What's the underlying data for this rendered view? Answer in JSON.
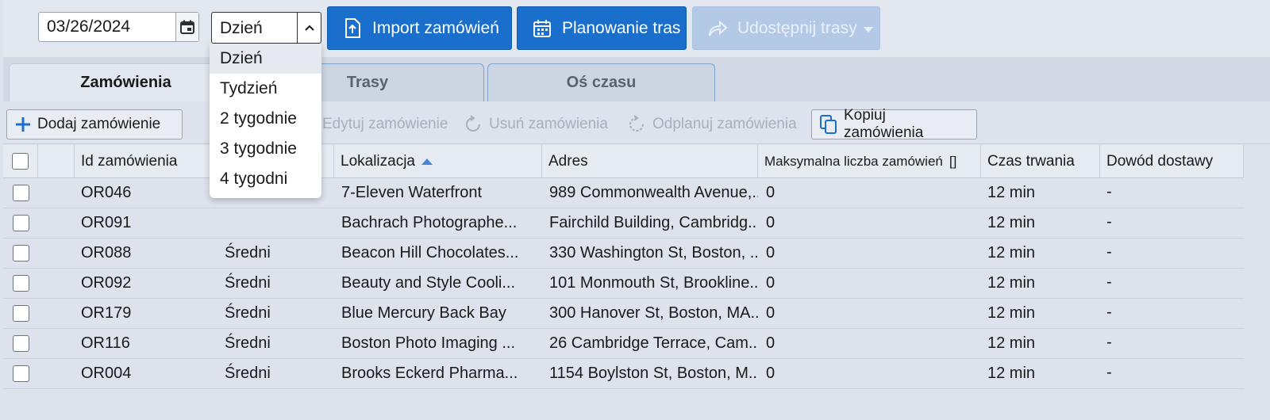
{
  "toolbar": {
    "date": "03/26/2024",
    "period_value": "Dzień",
    "import_label": "Import zamówień",
    "planning_label": "Planowanie tras",
    "share_label": "Udostępnij trasy"
  },
  "dropdown": {
    "options": [
      "Dzień",
      "Tydzień",
      "2 tygodnie",
      "3 tygodnie",
      "4 tygodni"
    ],
    "selected": "Dzień"
  },
  "tabs": [
    {
      "label": "Zamówienia",
      "active": true
    },
    {
      "label": "Trasy",
      "active": false
    },
    {
      "label": "Oś czasu",
      "active": false
    }
  ],
  "actions": {
    "add": "Dodaj zamówienie",
    "edit": "Edytuj zamówienie",
    "delete": "Usuń zamówienia",
    "unplan": "Odplanuj zamówienia",
    "copy": "Kopiuj zamówienia"
  },
  "table": {
    "columns": {
      "id": "Id zamówienia",
      "priority": "",
      "location": "Lokalizacja",
      "address": "Adres",
      "max_orders": "Maksymalna liczba zamówień",
      "duration": "Czas trwania",
      "proof": "Dowód dostawy"
    },
    "max_orders_marker": "[]",
    "sort_column": "location",
    "rows": [
      {
        "id": "OR046",
        "priority": "",
        "location": "7-Eleven Waterfront",
        "address": "989 Commonwealth Avenue,...",
        "max_orders": "0",
        "duration": "12 min",
        "proof": "-"
      },
      {
        "id": "OR091",
        "priority": "",
        "location": "Bachrach Photographe...",
        "address": "Fairchild Building, Cambridg...",
        "max_orders": "0",
        "duration": "12 min",
        "proof": "-"
      },
      {
        "id": "OR088",
        "priority": "Średni",
        "location": "Beacon Hill Chocolates...",
        "address": "330 Washington St, Boston, ...",
        "max_orders": "0",
        "duration": "12 min",
        "proof": "-"
      },
      {
        "id": "OR092",
        "priority": "Średni",
        "location": "Beauty and Style Cooli...",
        "address": "101 Monmouth St, Brookline...",
        "max_orders": "0",
        "duration": "12 min",
        "proof": "-"
      },
      {
        "id": "OR179",
        "priority": "Średni",
        "location": "Blue Mercury Back Bay",
        "address": "300 Hanover St, Boston, MA...",
        "max_orders": "0",
        "duration": "12 min",
        "proof": "-"
      },
      {
        "id": "OR116",
        "priority": "Średni",
        "location": "Boston Photo Imaging ...",
        "address": "26 Cambridge Terrace, Cam...",
        "max_orders": "0",
        "duration": "12 min",
        "proof": "-"
      },
      {
        "id": "OR004",
        "priority": "Średni",
        "location": "Brooks Eckerd Pharma...",
        "address": "1154 Boylston St, Boston, M...",
        "max_orders": "0",
        "duration": "12 min",
        "proof": "-"
      }
    ]
  }
}
